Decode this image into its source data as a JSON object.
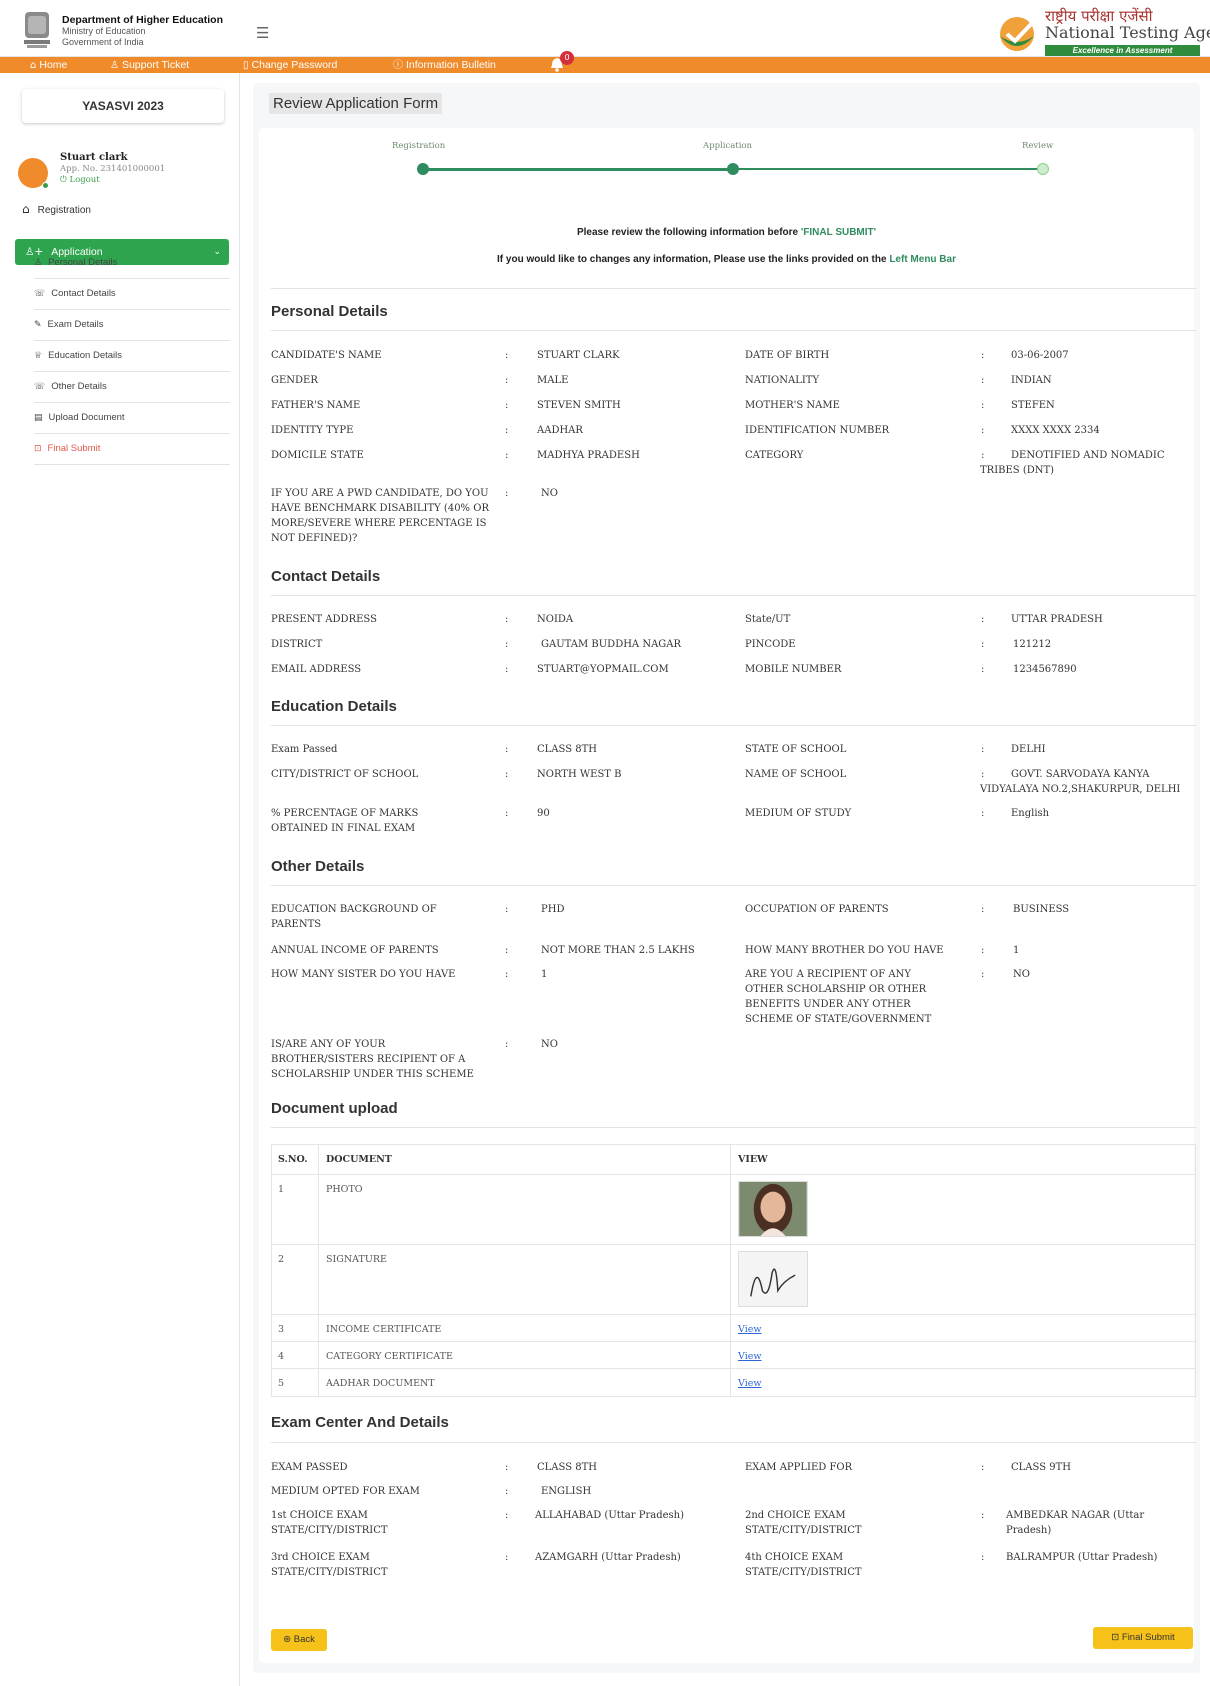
{
  "header": {
    "dept_line1": "Department of Higher Education",
    "dept_line2": "Ministry of Education",
    "dept_line3": "Government of India",
    "nta_hindi": "राष्ट्रीय परीक्षा एजेंसी",
    "nta_name": "National Testing Agency",
    "nta_tagline": "Excellence in Assessment",
    "menu_icon": "hamburger-icon",
    "notification_count": "0"
  },
  "nav": {
    "items": [
      {
        "icon": "home-icon",
        "label": "Home"
      },
      {
        "icon": "user-icon",
        "label": "Support Ticket"
      },
      {
        "icon": "lock-icon",
        "label": "Change Password"
      },
      {
        "icon": "info-icon",
        "label": "Information Bulletin"
      }
    ]
  },
  "sidebar": {
    "title": "YASASVI 2023",
    "user_name": "Stuart clark",
    "app_no": "App. No. 231401000001",
    "logout": "Logout",
    "registration": "Registration",
    "application": "Application",
    "items": [
      {
        "icon": "person-icon",
        "label": "Personal Details"
      },
      {
        "icon": "phone-icon",
        "label": "Contact Details"
      },
      {
        "icon": "exam-icon",
        "label": "Exam Details"
      },
      {
        "icon": "education-icon",
        "label": "Education Details"
      },
      {
        "icon": "phone-icon",
        "label": "Other Details"
      },
      {
        "icon": "upload-icon",
        "label": "Upload Document"
      },
      {
        "icon": "submit-icon",
        "label": "Final Submit"
      }
    ]
  },
  "main": {
    "title": "Review Application Form",
    "steps": [
      {
        "label": "Registration",
        "done": true
      },
      {
        "label": "Application",
        "done": true
      },
      {
        "label": "Review",
        "done": false
      }
    ],
    "notice1_pre": "Please review the following information before ",
    "notice1_hl": "'FINAL SUBMIT'",
    "notice2_pre": "If you would like to changes any information, Please use the links provided on the ",
    "notice2_hl": "Left Menu Bar"
  },
  "personal": {
    "title": "Personal Details",
    "fields": [
      {
        "label": "CANDIDATE'S NAME",
        "value": "STUART CLARK"
      },
      {
        "label": "DATE OF BIRTH",
        "value": "03-06-2007"
      },
      {
        "label": "GENDER",
        "value": "MALE"
      },
      {
        "label": "NATIONALITY",
        "value": "INDIAN"
      },
      {
        "label": "FATHER'S NAME",
        "value": "STEVEN SMITH"
      },
      {
        "label": "MOTHER'S NAME",
        "value": "STEFEN"
      },
      {
        "label": "IDENTITY TYPE",
        "value": "AADHAR"
      },
      {
        "label": "IDENTIFICATION NUMBER",
        "value": "XXXX XXXX 2334"
      },
      {
        "label": "DOMICILE STATE",
        "value": "MADHYA PRADESH"
      },
      {
        "label": "CATEGORY",
        "value": "DENOTIFIED AND NOMADIC TRIBES (DNT)"
      },
      {
        "label": "IF YOU ARE A PWD CANDIDATE, DO YOU HAVE BENCHMARK DISABILITY (40% OR MORE/SEVERE WHERE PERCENTAGE IS NOT DEFINED)?",
        "value": "NO"
      }
    ]
  },
  "contact": {
    "title": "Contact Details",
    "fields": [
      {
        "label": "PRESENT ADDRESS",
        "value": "NOIDA"
      },
      {
        "label": "State/UT",
        "value": "UTTAR PRADESH"
      },
      {
        "label": "DISTRICT",
        "value": "GAUTAM BUDDHA NAGAR"
      },
      {
        "label": "PINCODE",
        "value": "121212"
      },
      {
        "label": "EMAIL ADDRESS",
        "value": "STUART@YOPMAIL.COM"
      },
      {
        "label": "MOBILE NUMBER",
        "value": "1234567890"
      }
    ]
  },
  "education": {
    "title": "Education Details",
    "fields": [
      {
        "label": "Exam Passed",
        "value": "CLASS 8TH"
      },
      {
        "label": "STATE OF SCHOOL",
        "value": "DELHI"
      },
      {
        "label": "CITY/DISTRICT OF SCHOOL",
        "value": "NORTH WEST B"
      },
      {
        "label": "NAME OF SCHOOL",
        "value": "GOVT. SARVODAYA KANYA VIDYALAYA NO.2,SHAKURPUR, DELHI"
      },
      {
        "label": "% PERCENTAGE OF MARKS OBTAINED IN FINAL EXAM",
        "value": "90"
      },
      {
        "label": "MEDIUM OF STUDY",
        "value": "English"
      }
    ]
  },
  "other": {
    "title": "Other Details",
    "fields": [
      {
        "label": "EDUCATION BACKGROUND OF PARENTS",
        "value": "PHD"
      },
      {
        "label": "OCCUPATION OF PARENTS",
        "value": "BUSINESS"
      },
      {
        "label": "ANNUAL INCOME OF PARENTS",
        "value": "NOT MORE THAN 2.5 LAKHS"
      },
      {
        "label": "HOW MANY BROTHER DO YOU HAVE",
        "value": "1"
      },
      {
        "label": "HOW MANY SISTER DO YOU HAVE",
        "value": "1"
      },
      {
        "label": "ARE YOU A RECIPIENT OF ANY OTHER SCHOLARSHIP OR OTHER BENEFITS UNDER ANY OTHER SCHEME OF STATE/GOVERNMENT",
        "value": "NO"
      },
      {
        "label": "IS/ARE ANY OF YOUR BROTHER/SISTERS RECIPIENT OF A SCHOLARSHIP UNDER THIS SCHEME",
        "value": "NO"
      }
    ]
  },
  "documents": {
    "title": "Document upload",
    "headers": [
      "S.NO.",
      "DOCUMENT",
      "VIEW"
    ],
    "rows": [
      {
        "sno": "1",
        "name": "PHOTO",
        "view": ""
      },
      {
        "sno": "2",
        "name": "SIGNATURE",
        "view": ""
      },
      {
        "sno": "3",
        "name": "INCOME CERTIFICATE",
        "view": "View"
      },
      {
        "sno": "4",
        "name": "CATEGORY CERTIFICATE",
        "view": "View"
      },
      {
        "sno": "5",
        "name": "AADHAR DOCUMENT",
        "view": "View"
      }
    ]
  },
  "exam_center": {
    "title": "Exam Center And Details",
    "fields": [
      {
        "label": "EXAM PASSED",
        "value": "CLASS 8TH"
      },
      {
        "label": "EXAM APPLIED FOR",
        "value": "CLASS 9TH"
      },
      {
        "label": "MEDIUM OPTED FOR EXAM",
        "value": "ENGLISH"
      },
      {
        "label": "1st CHOICE EXAM STATE/CITY/DISTRICT",
        "value": "ALLAHABAD (Uttar Pradesh)"
      },
      {
        "label": "2nd CHOICE EXAM STATE/CITY/DISTRICT",
        "value": "AMBEDKAR NAGAR (Uttar Pradesh)"
      },
      {
        "label": "3rd CHOICE EXAM STATE/CITY/DISTRICT",
        "value": "AZAMGARH (Uttar Pradesh)"
      },
      {
        "label": "4th CHOICE EXAM STATE/CITY/DISTRICT",
        "value": "BALRAMPUR (Uttar Pradesh)"
      }
    ]
  },
  "buttons": {
    "back": "Back",
    "final_submit": "Final Submit"
  },
  "colors": {
    "nav": "#ef8b2b",
    "accent_green": "#2fa44f",
    "button_yellow": "#f6c21a",
    "link_blue": "#2d66d8"
  }
}
